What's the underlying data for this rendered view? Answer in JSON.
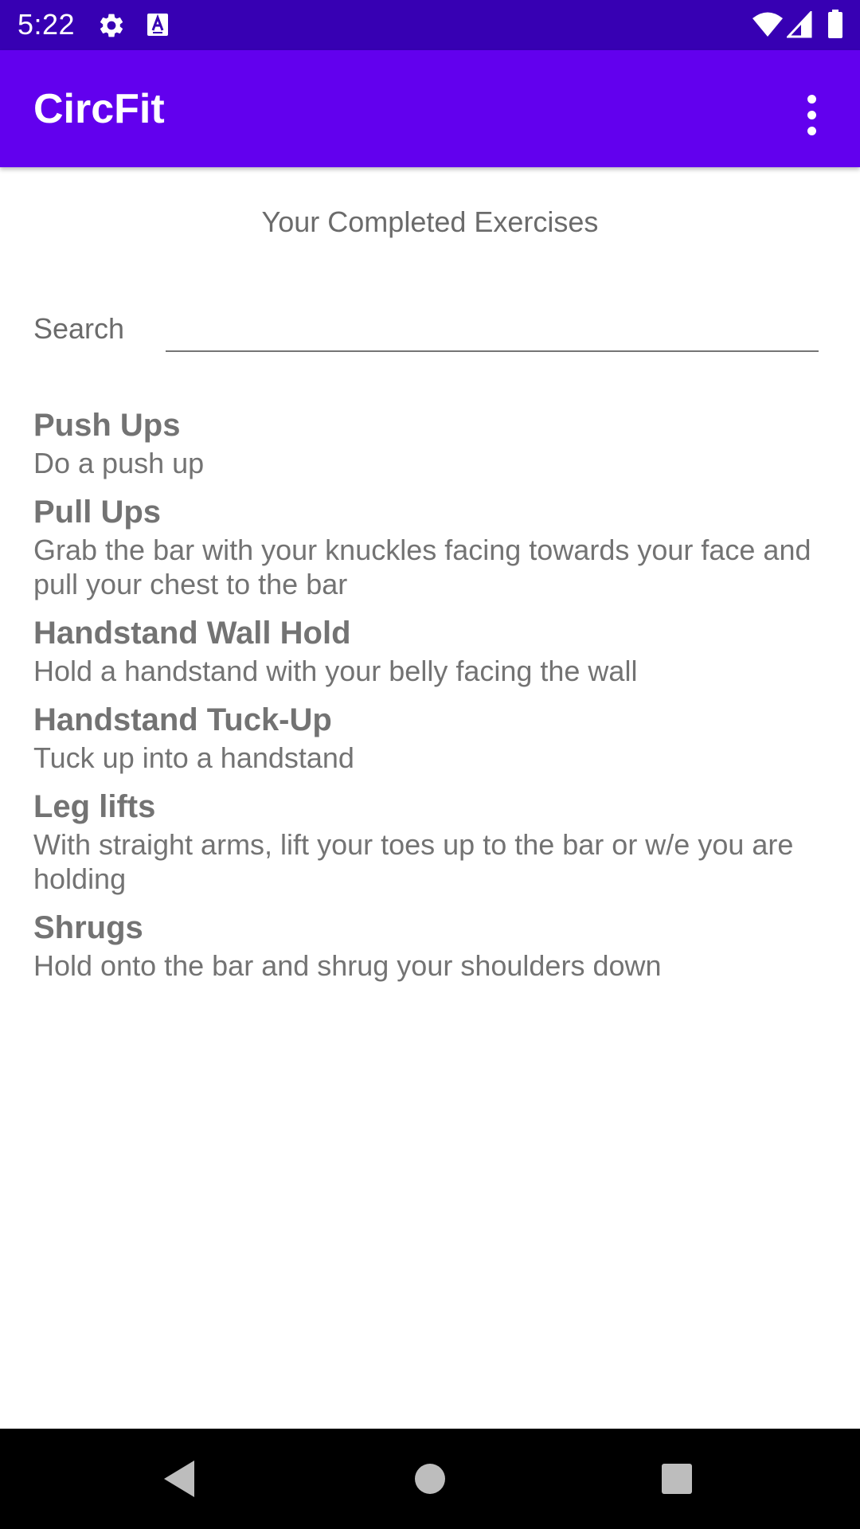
{
  "status_bar": {
    "time": "5:22",
    "icons": [
      "gear-icon",
      "text-a-icon",
      "wifi-icon",
      "signal-icon",
      "battery-icon"
    ],
    "background": "#3700b3"
  },
  "app_bar": {
    "title": "CircFit",
    "menu_icon": "more-vert-icon",
    "background": "#6200ee"
  },
  "main": {
    "heading": "Your Completed Exercises",
    "search": {
      "label": "Search",
      "value": "",
      "placeholder": ""
    },
    "exercises": [
      {
        "name": "Push Ups",
        "description": "Do a push up"
      },
      {
        "name": "Pull Ups",
        "description": "Grab the bar with your knuckles facing towards your face and pull your chest to the bar"
      },
      {
        "name": "Handstand Wall Hold",
        "description": "Hold a handstand with your belly facing the wall"
      },
      {
        "name": "Handstand Tuck-Up",
        "description": "Tuck up into a handstand"
      },
      {
        "name": "Leg lifts",
        "description": "With straight arms, lift your toes up to the bar or w/e you are holding"
      },
      {
        "name": "Shrugs",
        "description": "Hold onto the bar and shrug your shoulders down"
      }
    ]
  },
  "nav_bar": {
    "buttons": [
      "back-icon",
      "home-icon",
      "recents-icon"
    ]
  }
}
